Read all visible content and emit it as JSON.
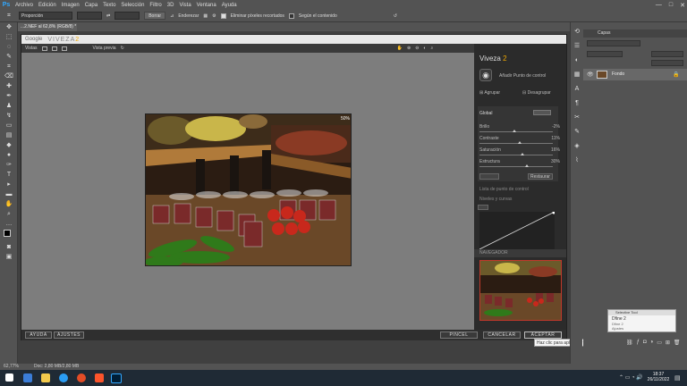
{
  "menubar": {
    "logo": "Ps",
    "items": [
      "Archivo",
      "Edición",
      "Imagen",
      "Capa",
      "Texto",
      "Selección",
      "Filtro",
      "3D",
      "Vista",
      "Ventana",
      "Ayuda"
    ],
    "controls": [
      "—",
      "□",
      "✕"
    ]
  },
  "options": {
    "style_value": "Proporción",
    "clear_label": "Borrar",
    "straighten_label": "Enderezar",
    "delete_cropped_label": "Eliminar píxeles recortados",
    "content_aware_label": "Según el contenido"
  },
  "document": {
    "tab_title": "...2.NEF al 62,8% (RGB/8) *"
  },
  "plugin": {
    "google_label": "Google",
    "brand": "VIVEZA",
    "brand_num": "2",
    "toolbar": {
      "views_label": "Vistas",
      "preview_label": "Vista previa"
    },
    "zoom_label": "50%",
    "side": {
      "title": "Viveza",
      "title_num": "2",
      "add_point_label": "Añadir Punto de control",
      "group_label": "Agrupar",
      "ungroup_label": "Desagrupar",
      "global_label": "Global",
      "sliders": [
        {
          "label": "Brillo",
          "value": "-2%",
          "position": 0.47
        },
        {
          "label": "Contraste",
          "value": "11%",
          "position": 0.55
        },
        {
          "label": "Saturación",
          "value": "16%",
          "position": 0.58
        },
        {
          "label": "Estructura",
          "value": "30%",
          "position": 0.65
        }
      ],
      "reset_label": "Restaurar",
      "control_list_label": "Lista de punto de control",
      "levels_label": "Niveles y curvas",
      "navigator_label": "NAVEGADOR"
    },
    "footer": {
      "help_label": "AYUDA",
      "settings_label": "AJUSTES",
      "brush_label": "PINCEL",
      "cancel_label": "CANCELAR",
      "accept_label": "ACEPTAR"
    },
    "tooltip": "Haz clic para aplicar el filtro"
  },
  "layers": {
    "tab_label": "Capas",
    "layer_name": "Fondo"
  },
  "selective_tool": {
    "title": "Selective Tool",
    "item": "Dfine 2",
    "item2": "Dfine 2",
    "settings": "Ajustes"
  },
  "status": {
    "zoom": "62,77%",
    "doc_size": "Doc: 2,80 MB/2,80 MB"
  },
  "taskbar": {
    "time": "18:37",
    "date": "26/11/2022"
  },
  "colors": {
    "ps_blue": "#31a8ff",
    "plugin_accent": "#f2a900",
    "navigator_box": "#c0392b"
  }
}
